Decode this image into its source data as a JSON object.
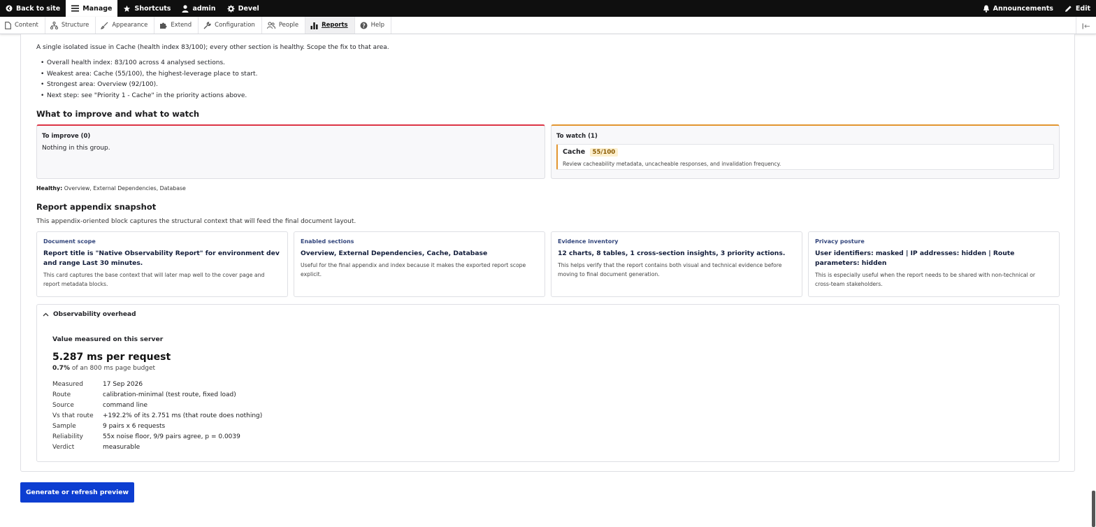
{
  "toolbar": {
    "back_to_site": "Back to site",
    "manage": "Manage",
    "shortcuts": "Shortcuts",
    "user": "admin",
    "devel": "Devel",
    "announcements": "Announcements",
    "edit": "Edit"
  },
  "tray": {
    "items": [
      {
        "label": "Content",
        "icon": "file-icon"
      },
      {
        "label": "Structure",
        "icon": "sitemap-icon"
      },
      {
        "label": "Appearance",
        "icon": "paintbrush-icon"
      },
      {
        "label": "Extend",
        "icon": "puzzle-icon"
      },
      {
        "label": "Configuration",
        "icon": "wrench-icon"
      },
      {
        "label": "People",
        "icon": "people-icon"
      },
      {
        "label": "Reports",
        "icon": "bar-chart-icon",
        "active": true
      },
      {
        "label": "Help",
        "icon": "help-icon"
      }
    ]
  },
  "summary": {
    "text": "A single isolated issue in Cache (health index 83/100); every other section is healthy. Scope the fix to that area.",
    "bullets": [
      "Overall health index: 83/100 across 4 analysed sections.",
      "Weakest area: Cache (55/100), the highest-leverage place to start.",
      "Strongest area: Overview (92/100).",
      "Next step: see \"Priority 1 - Cache\" in the priority actions above."
    ]
  },
  "improve_watch": {
    "heading": "What to improve and what to watch",
    "improve": {
      "title": "To improve (0)",
      "empty": "Nothing in this group.",
      "accent": "#dc3545"
    },
    "watch": {
      "title": "To watch (1)",
      "accent": "#e29530",
      "items": [
        {
          "name": "Cache",
          "score": "55/100",
          "description": "Review cacheability metadata, uncacheable responses, and invalidation frequency."
        }
      ]
    },
    "healthy_label": "Healthy:",
    "healthy_list": "Overview, External Dependencies, Database"
  },
  "appendix": {
    "heading": "Report appendix snapshot",
    "intro": "This appendix-oriented block captures the structural context that will feed the final document layout.",
    "cards": [
      {
        "label": "Document scope",
        "value": "Report title is \"Native Observability Report\" for environment dev and range Last 30 minutes.",
        "note": "This card captures the base context that will later map well to the cover page and report metadata blocks."
      },
      {
        "label": "Enabled sections",
        "value": "Overview, External Dependencies, Cache, Database",
        "note": "Useful for the final appendix and index because it makes the exported report scope explicit."
      },
      {
        "label": "Evidence inventory",
        "value": "12 charts, 8 tables, 1 cross-section insights, 3 priority actions.",
        "note": "This helps verify that the report contains both visual and technical evidence before moving to final document generation."
      },
      {
        "label": "Privacy posture",
        "value": "User identifiers: masked | IP addresses: hidden | Route parameters: hidden",
        "note": "This is especially useful when the report needs to be shared with non-technical or cross-team stakeholders."
      }
    ]
  },
  "overhead": {
    "summary": "Observability overhead",
    "heading": "Value measured on this server",
    "value": "5.287 ms per request",
    "budget_pct": "0.7%",
    "budget_text": "of an 800 ms page budget",
    "rows": [
      {
        "key": "Measured",
        "value": "17 Sep 2026"
      },
      {
        "key": "Route",
        "value": "calibration-minimal (test route, fixed load)"
      },
      {
        "key": "Source",
        "value": "command line"
      },
      {
        "key": "Vs that route",
        "value": "+192.2% of its 2.751 ms (that route does nothing)"
      },
      {
        "key": "Sample",
        "value": "9 pairs x 6 requests"
      },
      {
        "key": "Reliability",
        "value": "55x noise floor, 9/9 pairs agree, p = 0.0039"
      },
      {
        "key": "Verdict",
        "value": "measurable"
      }
    ]
  },
  "actions": {
    "generate_label": "Generate or refresh preview",
    "primary_color": "#0d3ed1"
  }
}
